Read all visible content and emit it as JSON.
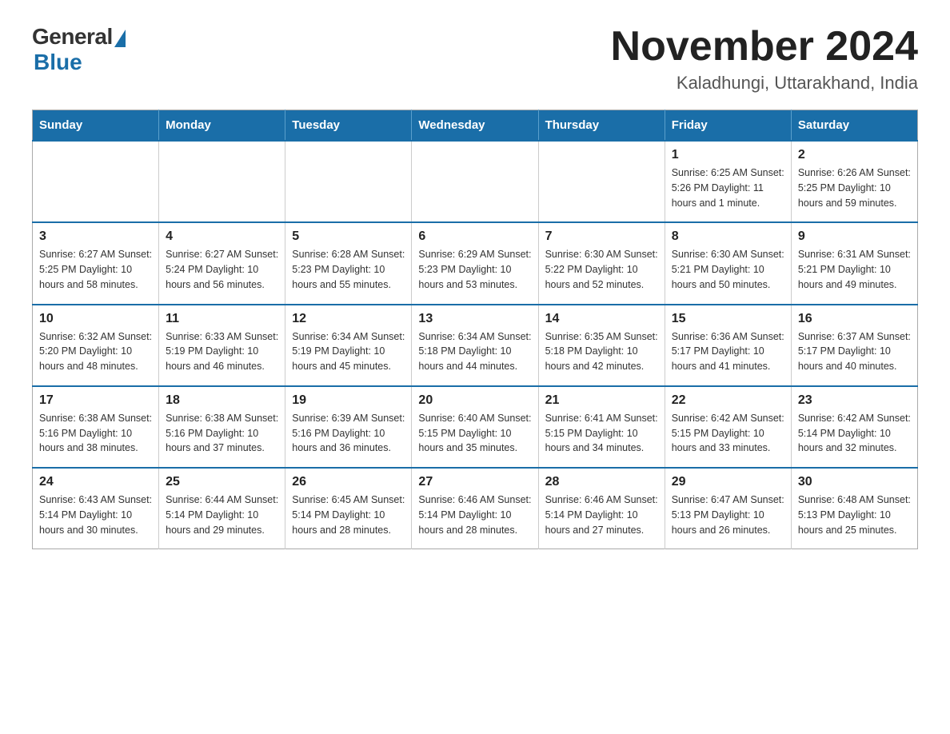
{
  "logo": {
    "general": "General",
    "blue": "Blue"
  },
  "title": "November 2024",
  "location": "Kaladhungi, Uttarakhand, India",
  "days_of_week": [
    "Sunday",
    "Monday",
    "Tuesday",
    "Wednesday",
    "Thursday",
    "Friday",
    "Saturday"
  ],
  "weeks": [
    [
      {
        "day": "",
        "info": ""
      },
      {
        "day": "",
        "info": ""
      },
      {
        "day": "",
        "info": ""
      },
      {
        "day": "",
        "info": ""
      },
      {
        "day": "",
        "info": ""
      },
      {
        "day": "1",
        "info": "Sunrise: 6:25 AM\nSunset: 5:26 PM\nDaylight: 11 hours and 1 minute."
      },
      {
        "day": "2",
        "info": "Sunrise: 6:26 AM\nSunset: 5:25 PM\nDaylight: 10 hours and 59 minutes."
      }
    ],
    [
      {
        "day": "3",
        "info": "Sunrise: 6:27 AM\nSunset: 5:25 PM\nDaylight: 10 hours and 58 minutes."
      },
      {
        "day": "4",
        "info": "Sunrise: 6:27 AM\nSunset: 5:24 PM\nDaylight: 10 hours and 56 minutes."
      },
      {
        "day": "5",
        "info": "Sunrise: 6:28 AM\nSunset: 5:23 PM\nDaylight: 10 hours and 55 minutes."
      },
      {
        "day": "6",
        "info": "Sunrise: 6:29 AM\nSunset: 5:23 PM\nDaylight: 10 hours and 53 minutes."
      },
      {
        "day": "7",
        "info": "Sunrise: 6:30 AM\nSunset: 5:22 PM\nDaylight: 10 hours and 52 minutes."
      },
      {
        "day": "8",
        "info": "Sunrise: 6:30 AM\nSunset: 5:21 PM\nDaylight: 10 hours and 50 minutes."
      },
      {
        "day": "9",
        "info": "Sunrise: 6:31 AM\nSunset: 5:21 PM\nDaylight: 10 hours and 49 minutes."
      }
    ],
    [
      {
        "day": "10",
        "info": "Sunrise: 6:32 AM\nSunset: 5:20 PM\nDaylight: 10 hours and 48 minutes."
      },
      {
        "day": "11",
        "info": "Sunrise: 6:33 AM\nSunset: 5:19 PM\nDaylight: 10 hours and 46 minutes."
      },
      {
        "day": "12",
        "info": "Sunrise: 6:34 AM\nSunset: 5:19 PM\nDaylight: 10 hours and 45 minutes."
      },
      {
        "day": "13",
        "info": "Sunrise: 6:34 AM\nSunset: 5:18 PM\nDaylight: 10 hours and 44 minutes."
      },
      {
        "day": "14",
        "info": "Sunrise: 6:35 AM\nSunset: 5:18 PM\nDaylight: 10 hours and 42 minutes."
      },
      {
        "day": "15",
        "info": "Sunrise: 6:36 AM\nSunset: 5:17 PM\nDaylight: 10 hours and 41 minutes."
      },
      {
        "day": "16",
        "info": "Sunrise: 6:37 AM\nSunset: 5:17 PM\nDaylight: 10 hours and 40 minutes."
      }
    ],
    [
      {
        "day": "17",
        "info": "Sunrise: 6:38 AM\nSunset: 5:16 PM\nDaylight: 10 hours and 38 minutes."
      },
      {
        "day": "18",
        "info": "Sunrise: 6:38 AM\nSunset: 5:16 PM\nDaylight: 10 hours and 37 minutes."
      },
      {
        "day": "19",
        "info": "Sunrise: 6:39 AM\nSunset: 5:16 PM\nDaylight: 10 hours and 36 minutes."
      },
      {
        "day": "20",
        "info": "Sunrise: 6:40 AM\nSunset: 5:15 PM\nDaylight: 10 hours and 35 minutes."
      },
      {
        "day": "21",
        "info": "Sunrise: 6:41 AM\nSunset: 5:15 PM\nDaylight: 10 hours and 34 minutes."
      },
      {
        "day": "22",
        "info": "Sunrise: 6:42 AM\nSunset: 5:15 PM\nDaylight: 10 hours and 33 minutes."
      },
      {
        "day": "23",
        "info": "Sunrise: 6:42 AM\nSunset: 5:14 PM\nDaylight: 10 hours and 32 minutes."
      }
    ],
    [
      {
        "day": "24",
        "info": "Sunrise: 6:43 AM\nSunset: 5:14 PM\nDaylight: 10 hours and 30 minutes."
      },
      {
        "day": "25",
        "info": "Sunrise: 6:44 AM\nSunset: 5:14 PM\nDaylight: 10 hours and 29 minutes."
      },
      {
        "day": "26",
        "info": "Sunrise: 6:45 AM\nSunset: 5:14 PM\nDaylight: 10 hours and 28 minutes."
      },
      {
        "day": "27",
        "info": "Sunrise: 6:46 AM\nSunset: 5:14 PM\nDaylight: 10 hours and 28 minutes."
      },
      {
        "day": "28",
        "info": "Sunrise: 6:46 AM\nSunset: 5:14 PM\nDaylight: 10 hours and 27 minutes."
      },
      {
        "day": "29",
        "info": "Sunrise: 6:47 AM\nSunset: 5:13 PM\nDaylight: 10 hours and 26 minutes."
      },
      {
        "day": "30",
        "info": "Sunrise: 6:48 AM\nSunset: 5:13 PM\nDaylight: 10 hours and 25 minutes."
      }
    ]
  ]
}
